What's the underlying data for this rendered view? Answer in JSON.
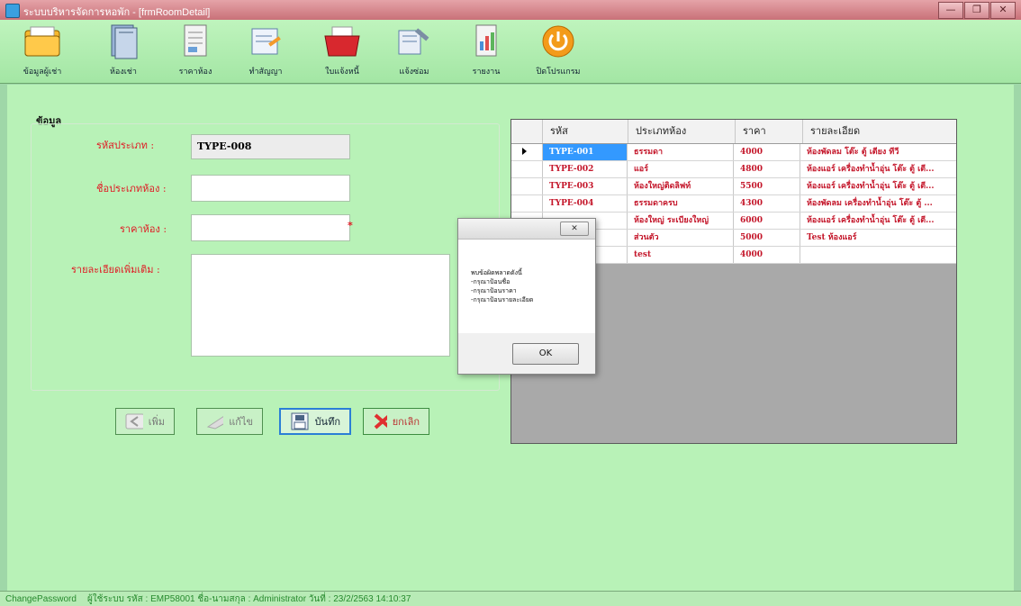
{
  "window": {
    "title": "ระบบบริหารจัดการหอพัก - [frmRoomDetail]",
    "controls": {
      "minimize": "—",
      "restore": "❐",
      "close": "✕"
    }
  },
  "toolbar": {
    "items": [
      {
        "label": "ข้อมูลผู้เช่า",
        "icon": "folder-icon"
      },
      {
        "label": "ห้องเช่า",
        "icon": "book-icon"
      },
      {
        "label": "ราคาห้อง",
        "icon": "document-icon"
      },
      {
        "label": "ทำสัญญา",
        "icon": "contract-icon"
      },
      {
        "label": "ใบแจ้งหนี้",
        "icon": "bill-folder-icon"
      },
      {
        "label": "แจ้งซ่อม",
        "icon": "repair-icon"
      },
      {
        "label": "รายงาน",
        "icon": "report-icon"
      },
      {
        "label": "ปิดโปรแกรม",
        "icon": "power-icon"
      }
    ]
  },
  "form": {
    "group_title": "ข้อมูล",
    "type_code_label": "รหัสประเภท :",
    "type_code_value": "TYPE-008",
    "type_name_label": "ชื่อประเภทห้อง :",
    "type_name_value": "",
    "price_label": "ราคาห้อง :",
    "price_value": "",
    "required_mark": "*",
    "detail_label": "รายละเอียดเพิ่มเติม :",
    "detail_value": ""
  },
  "buttons": {
    "add": "เพิ่ม",
    "edit": "แก้ไข",
    "save": "บันทึก",
    "cancel": "ยกเลิก"
  },
  "grid": {
    "headers": [
      "รหัส",
      "ประเภทห้อง",
      "ราคา",
      "รายละเอียด"
    ],
    "rows": [
      [
        "TYPE-001",
        "ธรรมดา",
        "4000",
        "ห้องพัดลม โต๊ะ ตู้ เตียง ทีวี"
      ],
      [
        "TYPE-002",
        "แอร์",
        "4800",
        "ห้องแอร์ เครื่องทำน้ำอุ่น โต๊ะ ตู้ เตี..."
      ],
      [
        "TYPE-003",
        "ห้องใหญ่ติดลิฟท์",
        "5500",
        "ห้องแอร์ เครื่องทำน้ำอุ่น โต๊ะ ตู้ เตี..."
      ],
      [
        "TYPE-004",
        "ธรรมดาครบ",
        "4300",
        "ห้องพัดลม เครื่องทำน้ำอุ่น โต๊ะ ตู้ ..."
      ],
      [
        "",
        "ห้องใหญ่ ระเบียงใหญ่",
        "6000",
        "ห้องแอร์ เครื่องทำน้ำอุ่น โต๊ะ ตู้ เตี..."
      ],
      [
        "",
        "ส่วนตัว",
        "5000",
        "Test ห้องแอร์"
      ],
      [
        "",
        "test",
        "4000",
        ""
      ]
    ]
  },
  "dialog": {
    "close_label": "✕",
    "message": "พบข้อผิดพลาดดังนี้\n-กรุณาป้อนชื่อ\n-กรุณาป้อนราคา\n-กรุณาป้อนรายละเอียด",
    "ok_label": "OK"
  },
  "status": {
    "change_password": "ChangePassword",
    "user_info": "ผู้ใช้ระบบ รหัส : EMP58001  ชื่อ-นามสกุล : Administrator  วันที่ : 23/2/2563 14:10:37"
  },
  "colors": {
    "background": "#b8f2b7",
    "toolbar": "#a3e6a4",
    "label_red": "#e01a24",
    "selection": "#3399ff"
  }
}
